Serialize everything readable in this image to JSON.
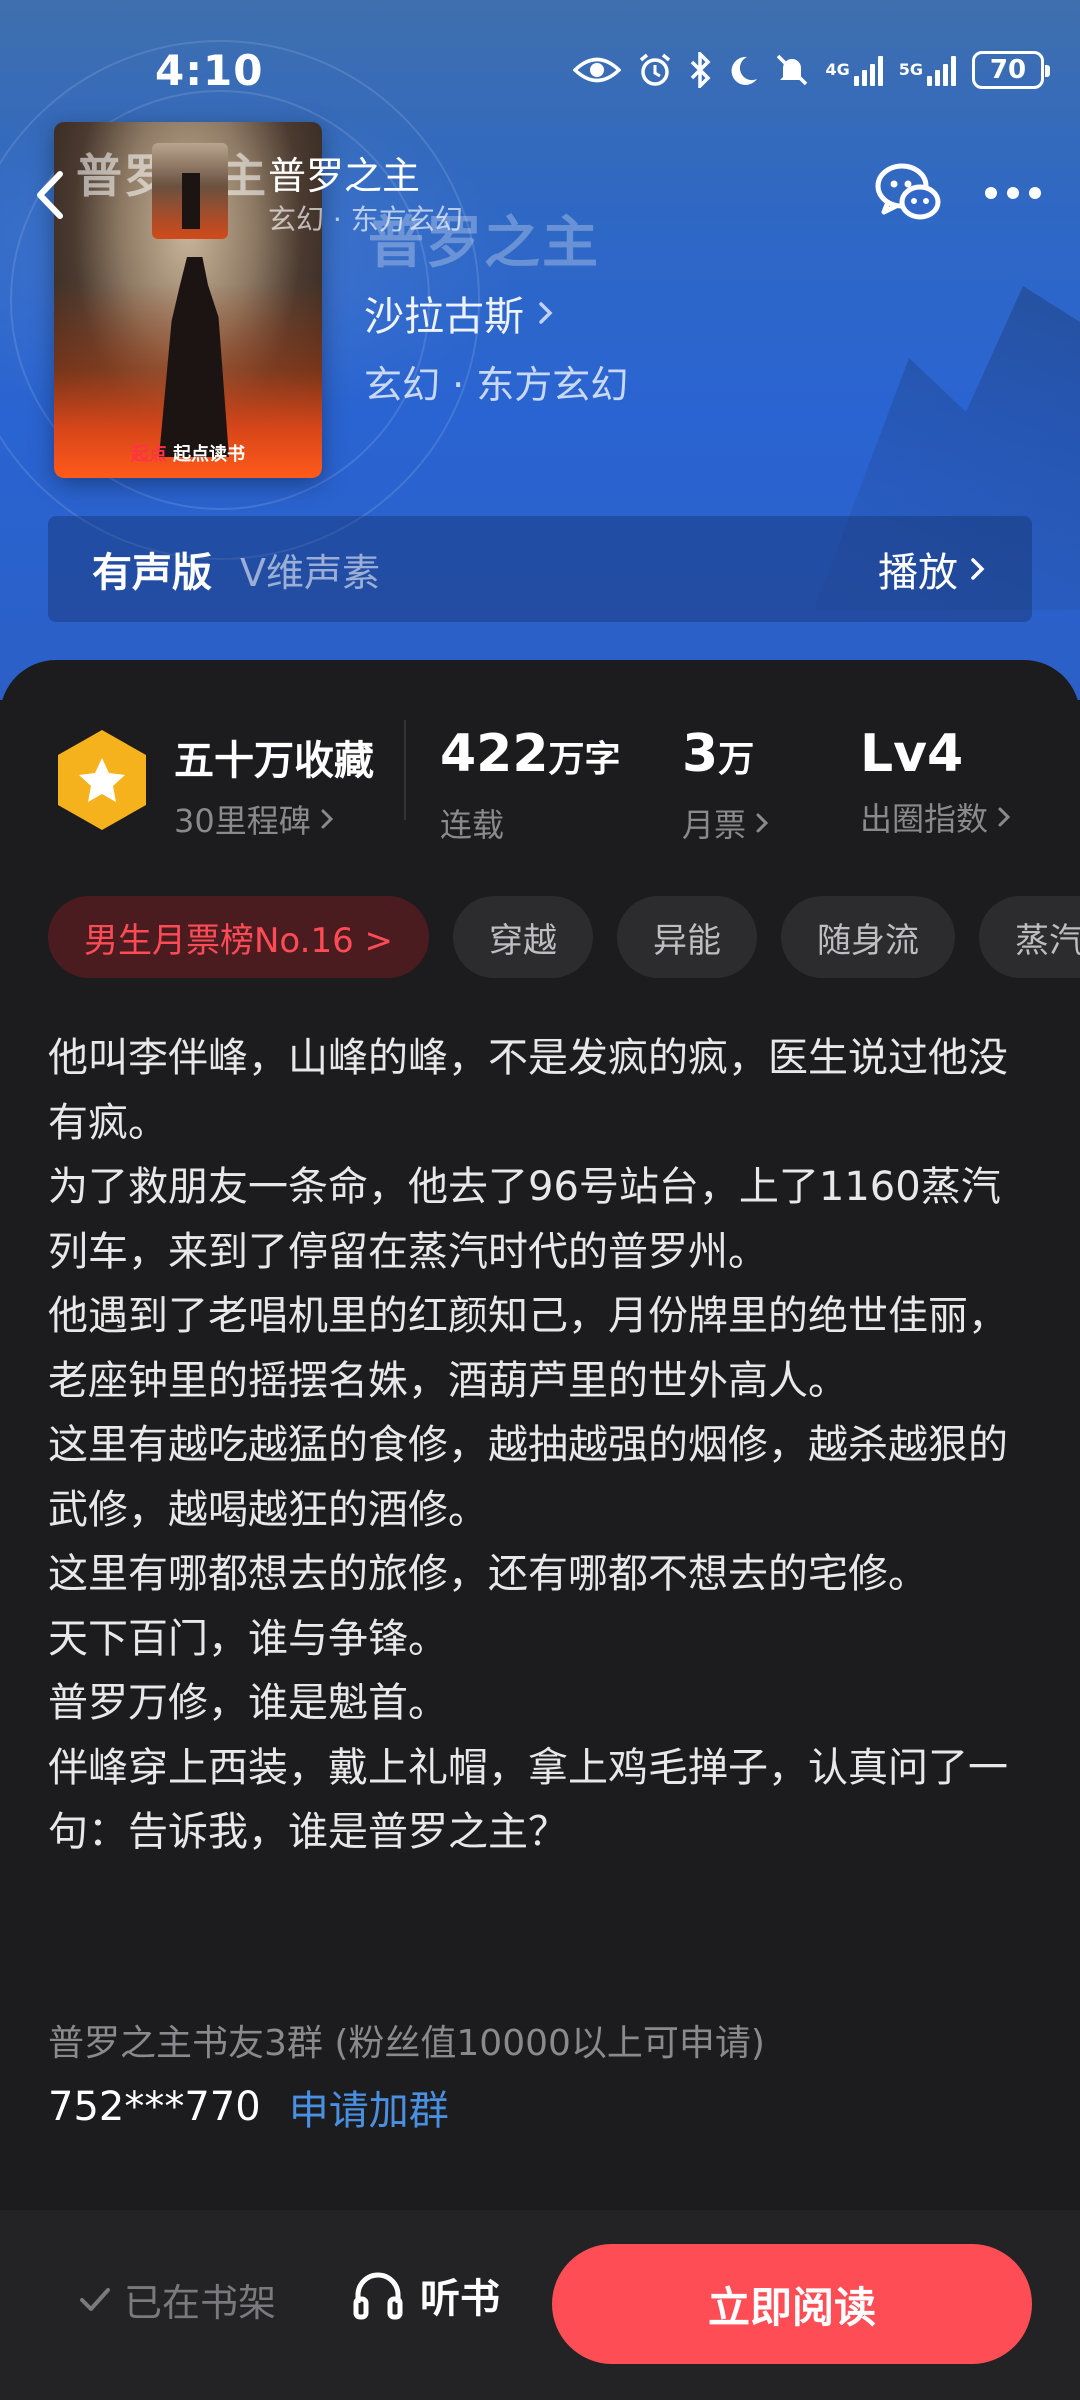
{
  "status_bar": {
    "time": "4:10",
    "network_1": "4G",
    "network_2": "5G",
    "battery": "70"
  },
  "nav": {
    "title": "普罗之主",
    "subtitle": "玄幻 · 东方玄幻"
  },
  "book": {
    "title": "普罗之主",
    "author": "沙拉古斯",
    "genre": "玄幻 · 东方玄幻",
    "cover_title_art": "普罗之主",
    "cover_brand_mark": "起点",
    "cover_brand": "起点读书"
  },
  "audio": {
    "label": "有声版",
    "voice": "V维声素",
    "play": "播放"
  },
  "stats": {
    "collect_title": "五十万收藏",
    "collect_sub": "30里程碑",
    "words_value": "422",
    "words_unit": "万字",
    "words_label": "连载",
    "tickets_value": "3",
    "tickets_unit": "万",
    "tickets_label": "月票",
    "level_value": "Lv4",
    "level_label": "出圈指数"
  },
  "tags": [
    "男生月票榜No.16 >",
    "穿越",
    "异能",
    "随身流",
    "蒸汽"
  ],
  "synopsis": [
    "他叫李伴峰，山峰的峰，不是发疯的疯，医生说过他没有疯。",
    "为了救朋友一条命，他去了96号站台，上了1160蒸汽列车，来到了停留在蒸汽时代的普罗州。",
    "他遇到了老唱机里的红颜知己，月份牌里的绝世佳丽，老座钟里的摇摆名姝，酒葫芦里的世外高人。",
    "这里有越吃越猛的食修，越抽越强的烟修，越杀越狠的武修，越喝越狂的酒修。",
    "这里有哪都想去的旅修，还有哪都不想去的宅修。",
    "天下百门，谁与争锋。",
    "普罗万修，谁是魁首。",
    "伴峰穿上西装，戴上礼帽，拿上鸡毛掸子，认真问了一句：告诉我，谁是普罗之主？"
  ],
  "group": {
    "info": "普罗之主书友3群 (粉丝值10000以上可申请)",
    "id": "752***770",
    "apply": "申请加群"
  },
  "bottom": {
    "shelf": "已在书架",
    "listen": "听书",
    "read": "立即阅读"
  },
  "colors": {
    "accent": "#ff4d56",
    "link": "#4a90e2",
    "badge": "#f5b21c"
  }
}
